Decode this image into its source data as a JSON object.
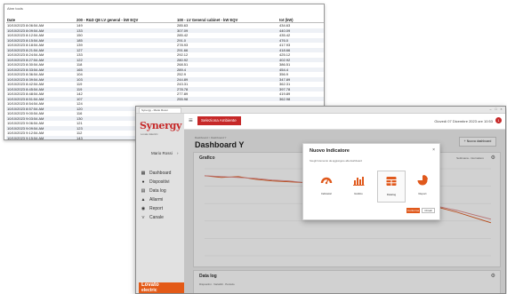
{
  "sheet": {
    "title": "Abm tools",
    "headers": [
      "Date",
      "200 - R&D QE LV general - kW EQV",
      "100 - LV General cabinet - kW EQV",
      "tot (kW)"
    ],
    "rows": [
      [
        "10/10/2023 8:06:54 AM",
        "149",
        "285.63",
        "434.63"
      ],
      [
        "10/10/2023 8:09:54 AM",
        "133",
        "307.09",
        "440.09"
      ],
      [
        "10/10/2023 8:12:54 AM",
        "150",
        "285.42",
        "435.42"
      ],
      [
        "10/10/2023 8:15:54 AM",
        "185",
        "291.0",
        "476.0"
      ],
      [
        "10/10/2023 8:18:54 AM",
        "139",
        "278.93",
        "417.93"
      ],
      [
        "10/10/2023 8:21:54 AM",
        "127",
        "291.66",
        "418.66"
      ],
      [
        "10/10/2023 8:24:54 AM",
        "133",
        "292.12",
        "425.12"
      ],
      [
        "10/10/2023 8:27:54 AM",
        "122",
        "280.92",
        "402.92"
      ],
      [
        "10/10/2023 8:30:54 AM",
        "118",
        "268.51",
        "386.51"
      ],
      [
        "10/10/2023 8:33:54 AM",
        "165",
        "289.4",
        "454.4"
      ],
      [
        "10/10/2023 8:36:54 AM",
        "104",
        "252.9",
        "356.9"
      ],
      [
        "10/10/2023 8:39:54 AM",
        "103",
        "244.89",
        "347.89"
      ],
      [
        "10/10/2023 8:42:54 AM",
        "119",
        "243.31",
        "362.31"
      ],
      [
        "10/10/2023 8:45:54 AM",
        "119",
        "278.78",
        "397.78"
      ],
      [
        "10/10/2023 8:48:54 AM",
        "142",
        "277.89",
        "419.89"
      ],
      [
        "10/10/2023 8:51:54 AM",
        "107",
        "255.98",
        "362.98"
      ],
      [
        "10/10/2023 8:54:54 AM",
        "124",
        "",
        ""
      ],
      [
        "10/10/2023 8:57:54 AM",
        "120",
        "",
        ""
      ],
      [
        "10/10/2023 9:00:54 AM",
        "116",
        "",
        ""
      ],
      [
        "10/10/2023 9:03:54 AM",
        "130",
        "",
        ""
      ],
      [
        "10/10/2023 9:06:54 AM",
        "121",
        "",
        ""
      ],
      [
        "10/10/2023 9:09:54 AM",
        "123",
        "",
        ""
      ],
      [
        "10/10/2023 9:12:54 AM",
        "112",
        "",
        ""
      ],
      [
        "10/10/2023 9:15:54 AM",
        "143",
        "",
        ""
      ],
      [
        "10/10/2023 9:18:54 AM",
        "116",
        "",
        ""
      ]
    ]
  },
  "window": {
    "tab_label": "Synergy - Mario Rossi",
    "controls": [
      "–",
      "□",
      "×"
    ],
    "logo": "Synergy",
    "logo_sub": "Lovato Electric",
    "user_name": "Mario Rossi",
    "nav": [
      {
        "label": "Dashboard",
        "icon": "dashboard-icon"
      },
      {
        "label": "Dispositivi",
        "icon": "devices-icon"
      },
      {
        "label": "Data log",
        "icon": "datalog-icon"
      },
      {
        "label": "Allarmi",
        "icon": "alarm-icon"
      },
      {
        "label": "Report",
        "icon": "report-icon"
      },
      {
        "label": "Canale",
        "icon": "channel-icon"
      }
    ],
    "brand": "Lovato",
    "brand_sub": "electric",
    "accent": "#c62828",
    "brand_color": "#e35a17"
  },
  "topbar": {
    "environment_button": "Seleziona Ambiente",
    "datetime": "Giovedì 07 Dicembre 2023 ore 10:53",
    "bell_count": "1"
  },
  "dashboard": {
    "breadcrumb": "Dashboard > Dashboard Y",
    "title": "Dashboard Y",
    "add_button": "+ Nuova dashboard",
    "chart_card_title": "Grafico",
    "chart_period": "Settimana - Giornaliero",
    "log_card_title": "Data log",
    "log_sub": "Dispositivi · Variabili · Periodo"
  },
  "modal": {
    "title": "Nuovo Indicatore",
    "subtitle": "Scegli l'elemento da aggiungere alla dashboard",
    "options": [
      {
        "label": "Indicatori",
        "icon": "gauge-icon",
        "selected": false
      },
      {
        "label": "Grafico",
        "icon": "bar-chart-icon",
        "selected": false
      },
      {
        "label": "Datalog",
        "icon": "table-icon",
        "selected": true
      },
      {
        "label": "Report",
        "icon": "pie-chart-icon",
        "selected": false
      }
    ],
    "confirm_button": "Conferma",
    "close_button": "Chiudi",
    "option_color": "#e0591c"
  },
  "chart_data": {
    "type": "line",
    "series": [
      {
        "values": [
          92,
          90,
          91,
          88,
          86,
          85,
          84,
          80,
          78,
          74,
          70,
          66,
          62,
          58,
          55,
          50,
          44,
          38
        ],
        "color": "#e0591c"
      },
      {
        "values": [
          92,
          91,
          90,
          89,
          87,
          86,
          84,
          81,
          79,
          76,
          72,
          68,
          64,
          60,
          56,
          52,
          47,
          42
        ],
        "color": "#e08a8a"
      }
    ],
    "ylim": [
      0,
      100
    ],
    "grid": true
  }
}
